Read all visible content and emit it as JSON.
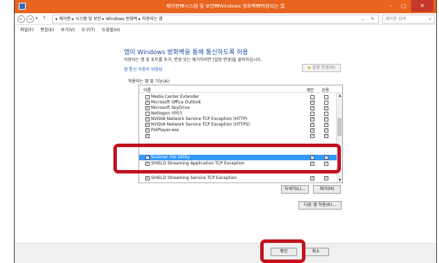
{
  "window": {
    "title": "제어판₩시스템 및 보안₩Windows 방화벽₩허용되는 앱",
    "minimize": "–",
    "maximize": "□",
    "close": "✕"
  },
  "address": {
    "back": "←",
    "forward": "→",
    "down": "▾",
    "up": "↑",
    "path": "▸ 제어판 ▸ 시스템 및 보안 ▸ Windows 방화벽 ▸ 허용되는 앱",
    "dropdown": "⌄",
    "refresh": "↻",
    "search_placeholder": "제어판 검색",
    "search_icon": "⌕"
  },
  "menu": {
    "file": "파일(F)",
    "edit": "편집(E)",
    "view": "보기(V)",
    "tools": "도구(T)",
    "help": "도움말(H)"
  },
  "main": {
    "heading": "앱이 Windows 방화벽을 통해 통신하도록 허용",
    "subtext": "허용되는 앱 및 포트를 추가, 변경 또는 제거하려면 [설정 변경]을 클릭하십시오.",
    "risk_link": "앱 통신 허용의 위험성",
    "change_settings": "설정 변경(N)",
    "allowed_label": "허용되는 앱 및 기능(A):"
  },
  "table": {
    "col_name": "이름",
    "col_private": "개인",
    "col_public": "공용",
    "rows": [
      {
        "name": "Media Center Extender",
        "enabled": false,
        "private": false,
        "public": false
      },
      {
        "name": "Microsoft Office Outlook",
        "enabled": true,
        "private": true,
        "public": false
      },
      {
        "name": "Microsoft SkyDrive",
        "enabled": true,
        "private": true,
        "public": true
      },
      {
        "name": "Netlogon 서비스",
        "enabled": false,
        "private": false,
        "public": false
      },
      {
        "name": "NVIDIA Network Service TCP Exception (HTTP)",
        "enabled": true,
        "private": true,
        "public": true
      },
      {
        "name": "NVIDIA Network Service TCP Exception (HTTPS)",
        "enabled": true,
        "private": true,
        "public": true
      },
      {
        "name": "PotPlayer.exe",
        "enabled": true,
        "private": true,
        "public": true
      },
      {
        "name": "",
        "enabled": true,
        "private": true,
        "public": true
      },
      {
        "name": "Scanner File Utility",
        "enabled": true,
        "private": true,
        "public": true,
        "selected": true
      },
      {
        "name": "SHIELD Streaming Application TCP Exception",
        "enabled": true,
        "private": true,
        "public": true
      },
      {
        "name": "",
        "enabled": true,
        "private": true,
        "public": true
      },
      {
        "name": "SHIELD Streaming Service TCP Exception",
        "enabled": true,
        "private": true,
        "public": true
      }
    ],
    "scroll_up": "▲",
    "scroll_down": "▼"
  },
  "buttons": {
    "details": "자세히(L)...",
    "remove": "제거(M)",
    "allow_other": "다른 앱 허용(R)...",
    "ok": "확인",
    "cancel": "취소"
  },
  "colors": {
    "titlebar": "#e8641f",
    "selection": "#3399ff",
    "highlight": "#c1121f",
    "heading": "#1e4e9e"
  }
}
